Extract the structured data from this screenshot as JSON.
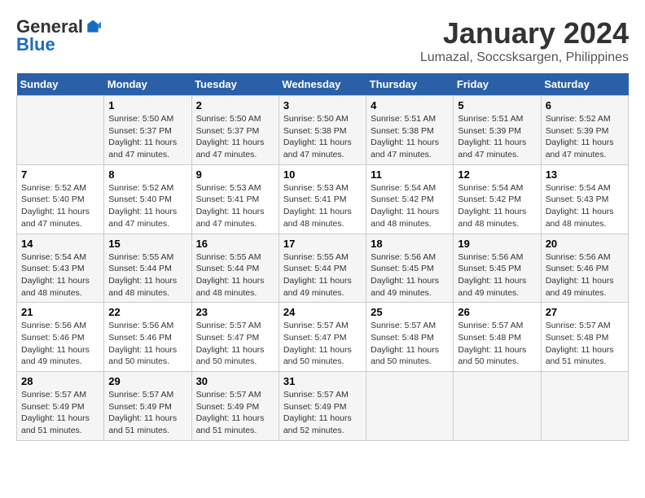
{
  "logo": {
    "general": "General",
    "blue": "Blue"
  },
  "title": "January 2024",
  "subtitle": "Lumazal, Soccsksargen, Philippines",
  "days_of_week": [
    "Sunday",
    "Monday",
    "Tuesday",
    "Wednesday",
    "Thursday",
    "Friday",
    "Saturday"
  ],
  "weeks": [
    [
      {
        "day": "",
        "info": ""
      },
      {
        "day": "1",
        "info": "Sunrise: 5:50 AM\nSunset: 5:37 PM\nDaylight: 11 hours\nand 47 minutes."
      },
      {
        "day": "2",
        "info": "Sunrise: 5:50 AM\nSunset: 5:37 PM\nDaylight: 11 hours\nand 47 minutes."
      },
      {
        "day": "3",
        "info": "Sunrise: 5:50 AM\nSunset: 5:38 PM\nDaylight: 11 hours\nand 47 minutes."
      },
      {
        "day": "4",
        "info": "Sunrise: 5:51 AM\nSunset: 5:38 PM\nDaylight: 11 hours\nand 47 minutes."
      },
      {
        "day": "5",
        "info": "Sunrise: 5:51 AM\nSunset: 5:39 PM\nDaylight: 11 hours\nand 47 minutes."
      },
      {
        "day": "6",
        "info": "Sunrise: 5:52 AM\nSunset: 5:39 PM\nDaylight: 11 hours\nand 47 minutes."
      }
    ],
    [
      {
        "day": "7",
        "info": "Sunrise: 5:52 AM\nSunset: 5:40 PM\nDaylight: 11 hours\nand 47 minutes."
      },
      {
        "day": "8",
        "info": "Sunrise: 5:52 AM\nSunset: 5:40 PM\nDaylight: 11 hours\nand 47 minutes."
      },
      {
        "day": "9",
        "info": "Sunrise: 5:53 AM\nSunset: 5:41 PM\nDaylight: 11 hours\nand 47 minutes."
      },
      {
        "day": "10",
        "info": "Sunrise: 5:53 AM\nSunset: 5:41 PM\nDaylight: 11 hours\nand 48 minutes."
      },
      {
        "day": "11",
        "info": "Sunrise: 5:54 AM\nSunset: 5:42 PM\nDaylight: 11 hours\nand 48 minutes."
      },
      {
        "day": "12",
        "info": "Sunrise: 5:54 AM\nSunset: 5:42 PM\nDaylight: 11 hours\nand 48 minutes."
      },
      {
        "day": "13",
        "info": "Sunrise: 5:54 AM\nSunset: 5:43 PM\nDaylight: 11 hours\nand 48 minutes."
      }
    ],
    [
      {
        "day": "14",
        "info": "Sunrise: 5:54 AM\nSunset: 5:43 PM\nDaylight: 11 hours\nand 48 minutes."
      },
      {
        "day": "15",
        "info": "Sunrise: 5:55 AM\nSunset: 5:44 PM\nDaylight: 11 hours\nand 48 minutes."
      },
      {
        "day": "16",
        "info": "Sunrise: 5:55 AM\nSunset: 5:44 PM\nDaylight: 11 hours\nand 48 minutes."
      },
      {
        "day": "17",
        "info": "Sunrise: 5:55 AM\nSunset: 5:44 PM\nDaylight: 11 hours\nand 49 minutes."
      },
      {
        "day": "18",
        "info": "Sunrise: 5:56 AM\nSunset: 5:45 PM\nDaylight: 11 hours\nand 49 minutes."
      },
      {
        "day": "19",
        "info": "Sunrise: 5:56 AM\nSunset: 5:45 PM\nDaylight: 11 hours\nand 49 minutes."
      },
      {
        "day": "20",
        "info": "Sunrise: 5:56 AM\nSunset: 5:46 PM\nDaylight: 11 hours\nand 49 minutes."
      }
    ],
    [
      {
        "day": "21",
        "info": "Sunrise: 5:56 AM\nSunset: 5:46 PM\nDaylight: 11 hours\nand 49 minutes."
      },
      {
        "day": "22",
        "info": "Sunrise: 5:56 AM\nSunset: 5:46 PM\nDaylight: 11 hours\nand 50 minutes."
      },
      {
        "day": "23",
        "info": "Sunrise: 5:57 AM\nSunset: 5:47 PM\nDaylight: 11 hours\nand 50 minutes."
      },
      {
        "day": "24",
        "info": "Sunrise: 5:57 AM\nSunset: 5:47 PM\nDaylight: 11 hours\nand 50 minutes."
      },
      {
        "day": "25",
        "info": "Sunrise: 5:57 AM\nSunset: 5:48 PM\nDaylight: 11 hours\nand 50 minutes."
      },
      {
        "day": "26",
        "info": "Sunrise: 5:57 AM\nSunset: 5:48 PM\nDaylight: 11 hours\nand 50 minutes."
      },
      {
        "day": "27",
        "info": "Sunrise: 5:57 AM\nSunset: 5:48 PM\nDaylight: 11 hours\nand 51 minutes."
      }
    ],
    [
      {
        "day": "28",
        "info": "Sunrise: 5:57 AM\nSunset: 5:49 PM\nDaylight: 11 hours\nand 51 minutes."
      },
      {
        "day": "29",
        "info": "Sunrise: 5:57 AM\nSunset: 5:49 PM\nDaylight: 11 hours\nand 51 minutes."
      },
      {
        "day": "30",
        "info": "Sunrise: 5:57 AM\nSunset: 5:49 PM\nDaylight: 11 hours\nand 51 minutes."
      },
      {
        "day": "31",
        "info": "Sunrise: 5:57 AM\nSunset: 5:49 PM\nDaylight: 11 hours\nand 52 minutes."
      },
      {
        "day": "",
        "info": ""
      },
      {
        "day": "",
        "info": ""
      },
      {
        "day": "",
        "info": ""
      }
    ]
  ]
}
